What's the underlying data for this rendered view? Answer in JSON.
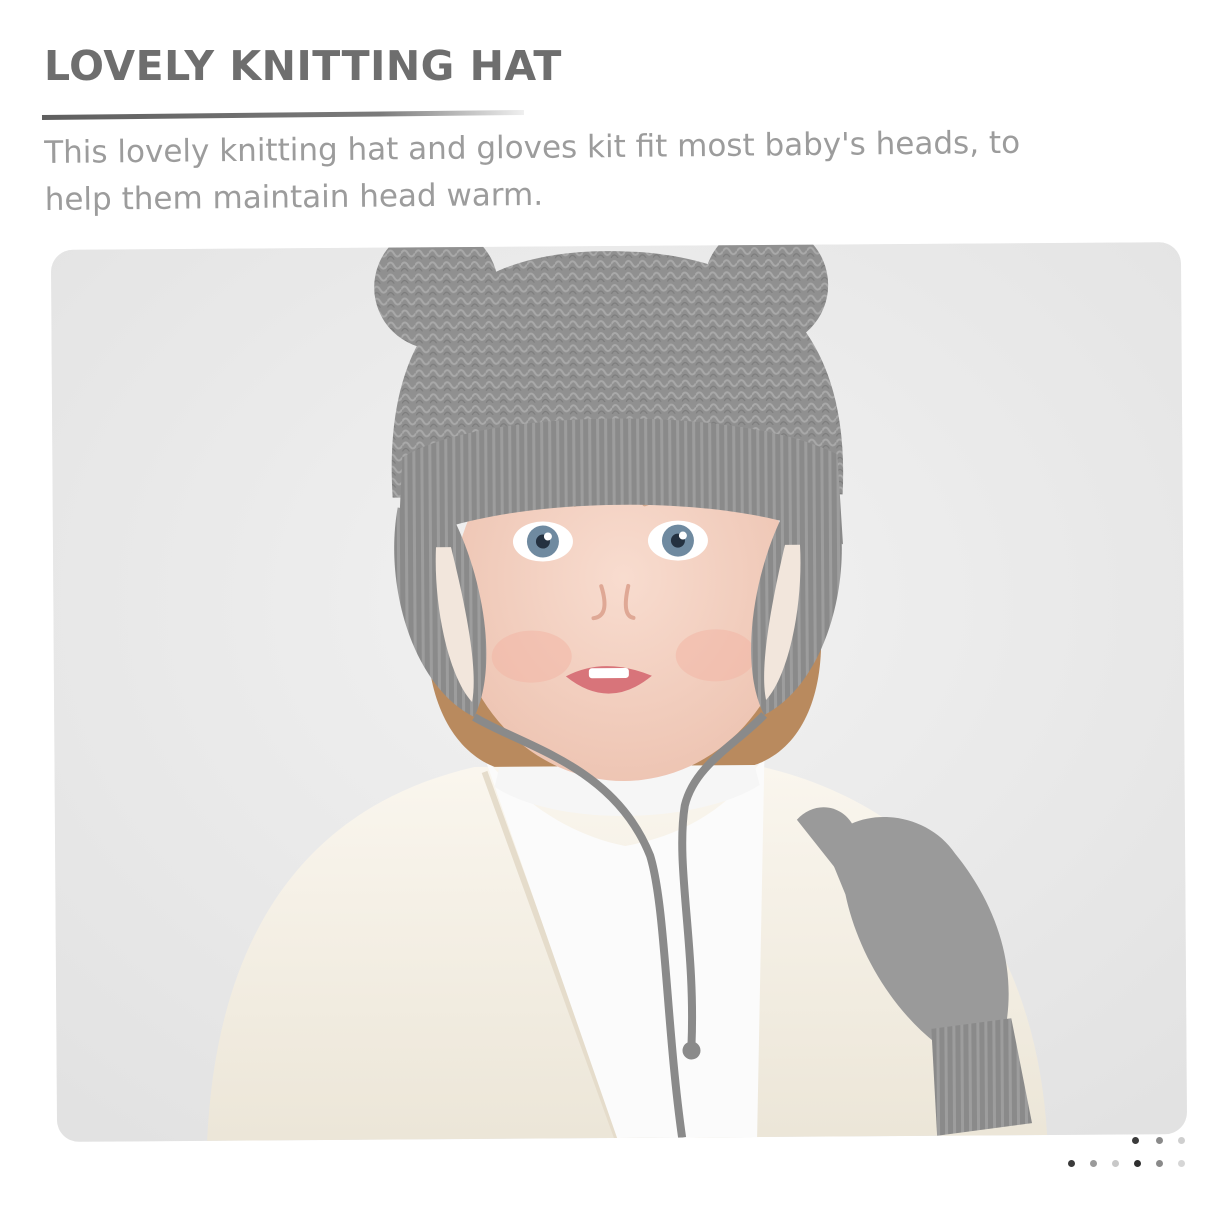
{
  "header": {
    "title": "LOVELY KNITTING HAT",
    "description": "This lovely knitting hat and gloves kit fit most baby's heads, to help them maintain head warm."
  },
  "photo": {
    "subject": "toddler wearing grey knitted bear-ear hat with ear flaps and ties, grey mitten, white turtleneck and cream cardigan",
    "colors": {
      "background": "#ebebeb",
      "knit_grey": "#8f8f8f",
      "knit_dark": "#7a7a7a",
      "skin": "#f3d2c4",
      "hair": "#b98a5e",
      "sweater": "#f7f3ea",
      "turtleneck": "#fbfbfb",
      "eyes": "#6f8aa0"
    }
  },
  "pager": {
    "active_index": 3,
    "colors": {
      "active": "#3a3a3a",
      "inactive": "#bdbdbd"
    }
  }
}
